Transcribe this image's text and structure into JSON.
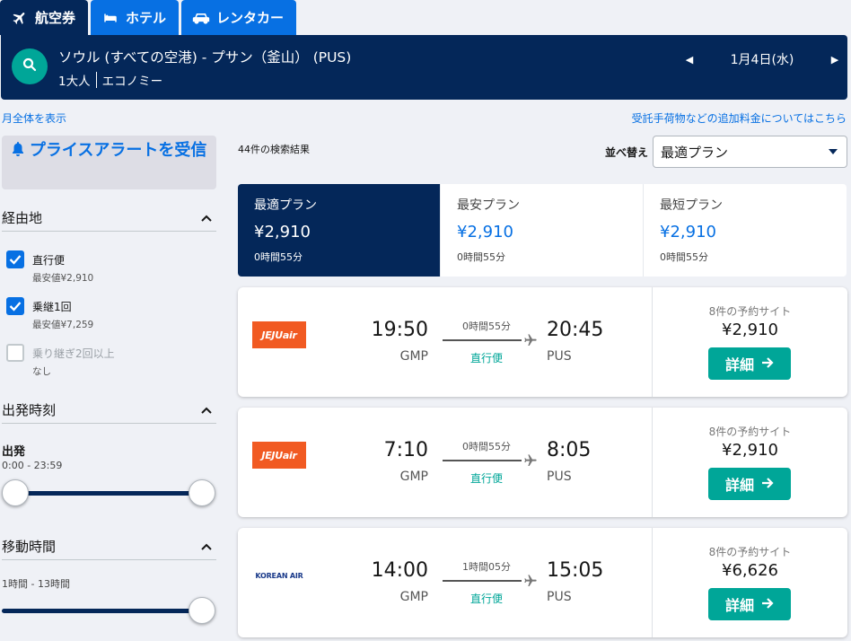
{
  "tabs": [
    {
      "label": "航空券",
      "icon": "plane-icon",
      "active": true
    },
    {
      "label": "ホテル",
      "icon": "bed-icon",
      "active": false
    },
    {
      "label": "レンタカー",
      "icon": "car-icon",
      "active": false
    }
  ],
  "search": {
    "route": "ソウル (すべての空港) - プサン（釜山） (PUS)",
    "passengers": "1大人",
    "cabin": "エコノミー",
    "date": "1月4日(水)"
  },
  "links": {
    "month_view": "月全体を表示",
    "baggage_fees": "受託手荷物などの追加料金についてはこちら"
  },
  "sidebar": {
    "price_alert": "プライスアラートを受信",
    "stops": {
      "title": "経由地",
      "options": [
        {
          "label": "直行便",
          "sub": "最安値¥2,910",
          "checked": true
        },
        {
          "label": "乗継1回",
          "sub": "最安値¥7,259",
          "checked": true
        },
        {
          "label": "乗り継ぎ2回以上",
          "sub": "なし",
          "checked": false
        }
      ]
    },
    "departure_time": {
      "title": "出発時刻",
      "label": "出発",
      "range": "0:00 - 23:59"
    },
    "duration": {
      "title": "移動時間",
      "range": "1時間 - 13時間"
    }
  },
  "results": {
    "count": "44件の検索結果",
    "sort_label": "並べ替え",
    "sort_value": "最適プラン",
    "plans": [
      {
        "title": "最適プラン",
        "price": "¥2,910",
        "duration": "0時間55分",
        "active": true
      },
      {
        "title": "最安プラン",
        "price": "¥2,910",
        "duration": "0時間55分",
        "active": false
      },
      {
        "title": "最短プラン",
        "price": "¥2,910",
        "duration": "0時間55分",
        "active": false
      }
    ],
    "flights": [
      {
        "airline": "JEJUair",
        "dep_time": "19:50",
        "dep_code": "GMP",
        "duration": "0時間55分",
        "stops": "直行便",
        "arr_time": "20:45",
        "arr_code": "PUS",
        "sites": "8件の予約サイト",
        "price": "¥2,910",
        "button": "詳細"
      },
      {
        "airline": "JEJUair",
        "dep_time": "7:10",
        "dep_code": "GMP",
        "duration": "0時間55分",
        "stops": "直行便",
        "arr_time": "8:05",
        "arr_code": "PUS",
        "sites": "8件の予約サイト",
        "price": "¥2,910",
        "button": "詳細"
      },
      {
        "airline": "KOREAN AIR",
        "dep_time": "14:00",
        "dep_code": "GMP",
        "duration": "1時間05分",
        "stops": "直行便",
        "arr_time": "15:05",
        "arr_code": "PUS",
        "sites": "8件の予約サイト",
        "price": "¥6,626",
        "button": "詳細"
      }
    ]
  },
  "colors": {
    "navy": "#042759",
    "blue": "#0770e3",
    "teal": "#00a698",
    "background": "#eff1f6"
  }
}
